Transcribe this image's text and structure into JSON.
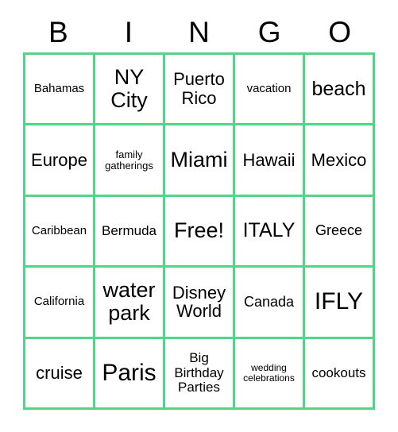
{
  "card": {
    "title": "BINGO",
    "header_letters": [
      "B",
      "I",
      "N",
      "G",
      "O"
    ],
    "border_color": "#52d48a",
    "background_color": "#ffffff",
    "text_color": "#000000",
    "rows": 5,
    "columns": 5,
    "cells": [
      [
        {
          "text": "Bahamas",
          "size": "fs-sm"
        },
        {
          "text": "NY City",
          "size": "fs-xxl"
        },
        {
          "text": "Puerto Rico",
          "size": "fs-l"
        },
        {
          "text": "vacation",
          "size": "fs-sm"
        },
        {
          "text": "beach",
          "size": "fs-xl"
        }
      ],
      [
        {
          "text": "Europe",
          "size": "fs-l"
        },
        {
          "text": "family gatherings",
          "size": "fs-s"
        },
        {
          "text": "Miami",
          "size": "fs-xxl"
        },
        {
          "text": "Hawaii",
          "size": "fs-l"
        },
        {
          "text": "Mexico",
          "size": "fs-l"
        }
      ],
      [
        {
          "text": "Caribbean",
          "size": "fs-sm"
        },
        {
          "text": "Bermuda",
          "size": "fs-m"
        },
        {
          "text": "Free!",
          "size": "fs-xxl"
        },
        {
          "text": "ITALY",
          "size": "fs-xl"
        },
        {
          "text": "Greece",
          "size": "fs-ml"
        }
      ],
      [
        {
          "text": "California",
          "size": "fs-sm"
        },
        {
          "text": "water park",
          "size": "fs-xxl"
        },
        {
          "text": "Disney World",
          "size": "fs-l"
        },
        {
          "text": "Canada",
          "size": "fs-ml"
        },
        {
          "text": "IFLY",
          "size": "fs-huge"
        }
      ],
      [
        {
          "text": "cruise",
          "size": "fs-l"
        },
        {
          "text": "Paris",
          "size": "fs-huge"
        },
        {
          "text": "Big Birthday Parties",
          "size": "fs-m"
        },
        {
          "text": "wedding celebrations",
          "size": "fs-xs"
        },
        {
          "text": "cookouts",
          "size": "fs-m"
        }
      ]
    ]
  }
}
